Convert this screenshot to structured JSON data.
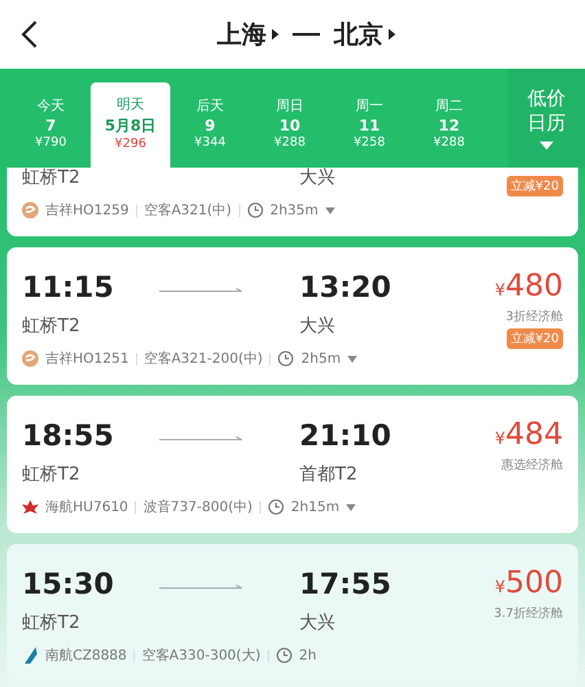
{
  "header": {
    "origin": "上海",
    "destination": "北京"
  },
  "dates": [
    {
      "weekday": "今天",
      "day": "7",
      "price": "¥790",
      "selected": false
    },
    {
      "weekday": "明天",
      "day": "5月8日",
      "price": "¥296",
      "selected": true
    },
    {
      "weekday": "后天",
      "day": "9",
      "price": "¥344",
      "selected": false
    },
    {
      "weekday": "周日",
      "day": "10",
      "price": "¥288",
      "selected": false
    },
    {
      "weekday": "周一",
      "day": "11",
      "price": "¥258",
      "selected": false
    },
    {
      "weekday": "周二",
      "day": "12",
      "price": "¥288",
      "selected": false
    }
  ],
  "calendar_button": {
    "label": "低价日历"
  },
  "flights": [
    {
      "depart_airport": "虹桥T2",
      "arrive_airport": "大兴",
      "badge": "立减¥20",
      "kind": "juneyao",
      "airline": "吉祥HO1259",
      "aircraft": "空客A321(中)",
      "duration": "2h35m",
      "expand_caret": true,
      "highlighted": false
    },
    {
      "depart_time": "11:15",
      "arrive_time": "13:20",
      "depart_airport": "虹桥T2",
      "arrive_airport": "大兴",
      "price": "480",
      "currency": "¥",
      "cabin": "3折经济舱",
      "badge": "立减¥20",
      "kind": "juneyao",
      "airline": "吉祥HO1251",
      "aircraft": "空客A321-200(中)",
      "duration": "2h5m",
      "expand_caret": true,
      "highlighted": false
    },
    {
      "depart_time": "18:55",
      "arrive_time": "21:10",
      "depart_airport": "虹桥T2",
      "arrive_airport": "首都T2",
      "price": "484",
      "currency": "¥",
      "cabin": "惠选经济舱",
      "kind": "hainan",
      "airline": "海航HU7610",
      "aircraft": "波音737-800(中)",
      "duration": "2h15m",
      "expand_caret": true,
      "highlighted": false
    },
    {
      "depart_time": "15:30",
      "arrive_time": "17:55",
      "depart_airport": "虹桥T2",
      "arrive_airport": "大兴",
      "price": "500",
      "currency": "¥",
      "cabin": "3.7折经济舱",
      "kind": "southern",
      "airline": "南航CZ8888",
      "aircraft": "空客A330-300(大)",
      "duration": "2h",
      "expand_caret": false,
      "highlighted": true
    }
  ]
}
